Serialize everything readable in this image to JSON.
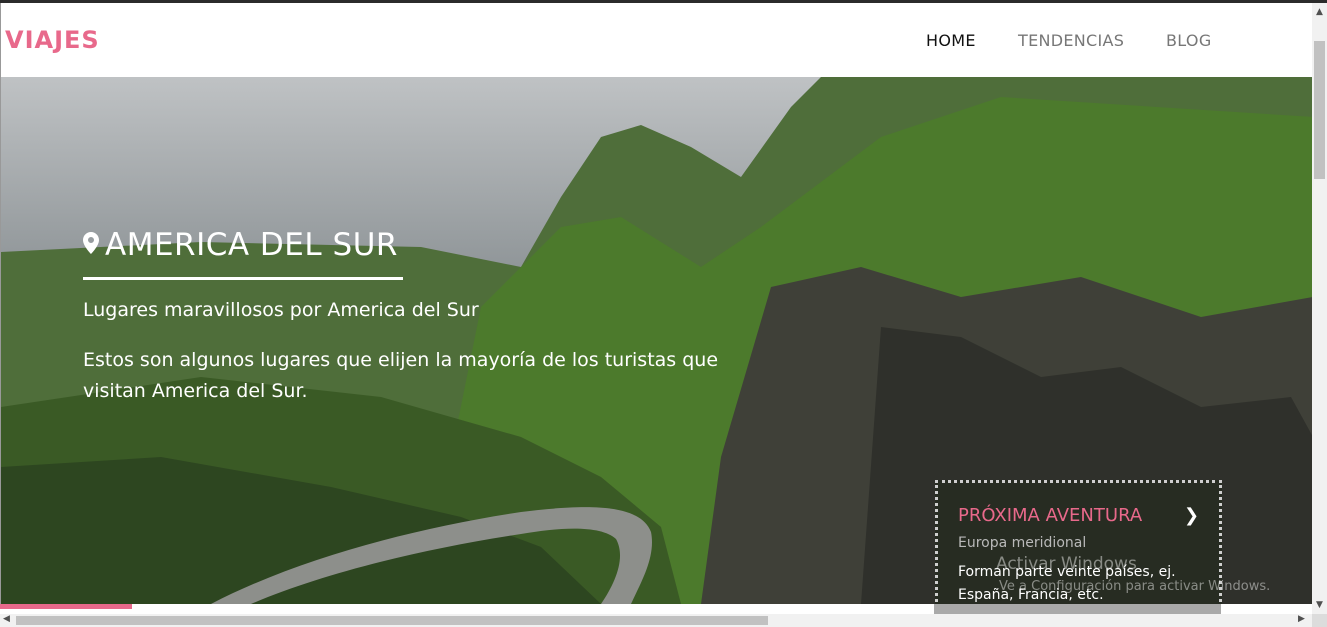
{
  "header": {
    "logo": "VIAJES",
    "nav": [
      {
        "label": "HOME"
      },
      {
        "label": "TENDENCIAS"
      },
      {
        "label": "BLOG"
      }
    ]
  },
  "hero": {
    "title": "AMERICA DEL SUR",
    "subtitle": "Lugares maravillosos por America del Sur",
    "description": "Estos son algunos lugares que elijen la mayoría de los turistas que visitan America del Sur."
  },
  "next_adventure": {
    "title": "PRÓXIMA AVENTURA",
    "region": "Europa meridional",
    "text": "Forman parte veinte países, ej. España, Francia, etc."
  },
  "watermark": {
    "title": "Activar Windows",
    "subtitle": "Ve a Configuración para activar Windows."
  },
  "colors": {
    "accent": "#e8698b",
    "nav_active": "#111111",
    "nav_inactive": "#777777"
  },
  "icons": [
    "map-pin-icon",
    "chevron-right-icon"
  ]
}
